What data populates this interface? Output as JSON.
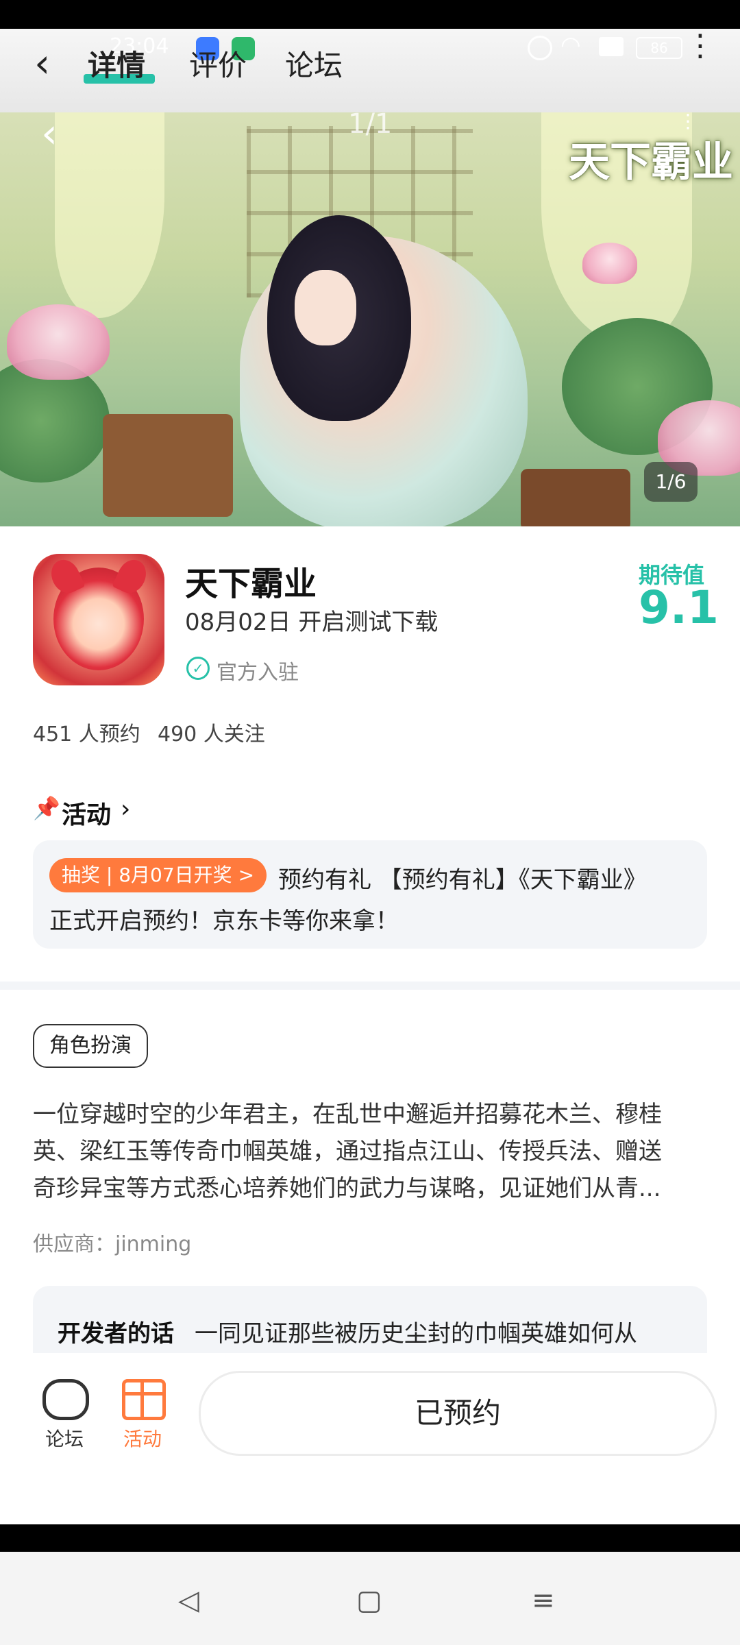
{
  "status_bar": {
    "time": "23:04",
    "battery": "86"
  },
  "header": {
    "tabs": [
      {
        "label": "详情"
      },
      {
        "label": "评价"
      },
      {
        "label": "论坛"
      }
    ],
    "accent_color": "#27c1a8"
  },
  "hero": {
    "logo_text": "天下霸业",
    "pager_top": "1/1",
    "counter": "1/6"
  },
  "app": {
    "title": "天下霸业",
    "date": "08月02日 开启测试下载",
    "official": "官方入驻",
    "expect_label": "期待值",
    "expect_score": "9.1",
    "booked": "451 人预约",
    "follow": "490 人关注"
  },
  "activity": {
    "title": "活动",
    "badge": "抽奖 | 8月07日开奖 >",
    "text_line1": "预约有礼 【预约有礼】《天下霸业》",
    "text_line2": "正式开启预约！京东卡等你来拿！"
  },
  "description": {
    "genre": "角色扮演",
    "lines": [
      "一位穿越时空的少年君主，在乱世中邂逅并招募花木兰、穆桂",
      "英、梁红玉等传奇巾帼英雄，通过指点江山、传授兵法、赠送",
      "奇珍异宝等方式悉心培养她们的武力与谋略，见证她们从青..."
    ],
    "supplier": "供应商：jinming"
  },
  "developer": {
    "label": "开发者的话",
    "text": "一同见证那些被历史尘封的巾帼英雄如何从"
  },
  "bottom": {
    "forum_label": "论坛",
    "activity_label": "活动",
    "reserve_label": "已预约",
    "activity_color": "#ff7a3d"
  }
}
